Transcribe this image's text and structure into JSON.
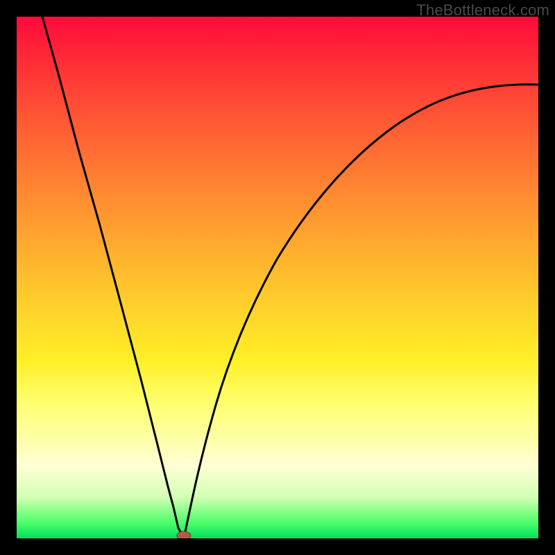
{
  "watermark": "TheBottleneck.com",
  "colors": {
    "frame": "#000000",
    "top": "#ff0a3a",
    "mid": "#ffff70",
    "bottom": "#00e060",
    "curve": "#000000",
    "dot": "#b55a4a"
  },
  "chart_data": {
    "type": "line",
    "title": "",
    "xlabel": "",
    "ylabel": "",
    "xlim": [
      0,
      100
    ],
    "ylim": [
      0,
      100
    ],
    "grid": false,
    "legend": false,
    "annotations": [
      "TheBottleneck.com"
    ],
    "minimum_x": 32,
    "series": [
      {
        "name": "left-branch",
        "x": [
          5,
          8,
          12,
          16,
          20,
          24,
          27,
          29,
          30,
          31,
          32
        ],
        "values": [
          100,
          89,
          74,
          60,
          45,
          30,
          18,
          10,
          6,
          2,
          0
        ]
      },
      {
        "name": "right-branch",
        "x": [
          32,
          33,
          34,
          36,
          38,
          41,
          45,
          50,
          56,
          63,
          71,
          80,
          90,
          100
        ],
        "values": [
          0,
          3,
          8,
          17,
          25,
          35,
          45,
          54,
          62,
          69,
          75,
          80,
          84,
          87
        ]
      }
    ],
    "minimum_marker": {
      "x": 32,
      "y": 0
    }
  }
}
